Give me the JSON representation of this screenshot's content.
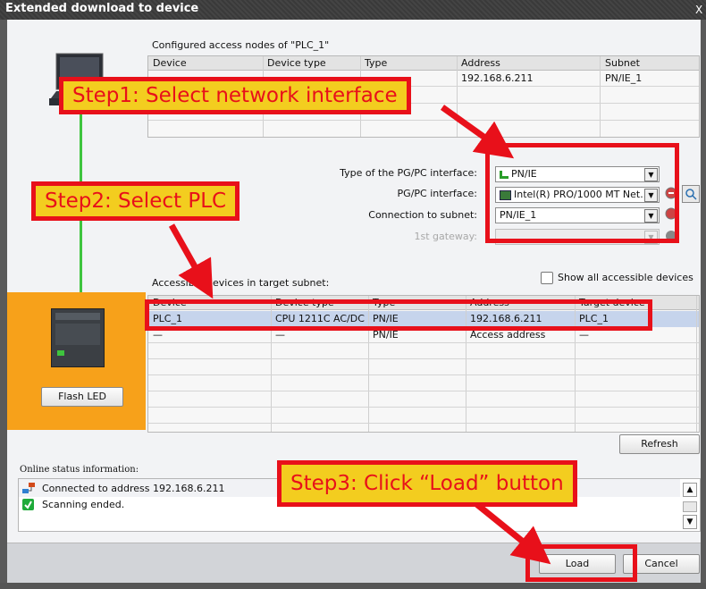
{
  "window": {
    "title": "Extended download to device",
    "close": "X"
  },
  "configured": {
    "heading": "Configured access nodes of \"PLC_1\"",
    "columns": [
      "Device",
      "Device type",
      "Type",
      "Address",
      "Subnet"
    ],
    "row": [
      "",
      "",
      "",
      "192.168.6.211",
      "PN/IE_1"
    ]
  },
  "interface": {
    "type_label": "Type of the PG/PC interface:",
    "type_value": "PN/IE",
    "pgpc_label": "PG/PC interface:",
    "pgpc_value": "Intel(R) PRO/1000 MT Net...",
    "subnet_label": "Connection to subnet:",
    "subnet_value": "PN/IE_1",
    "gateway_label": "1st gateway:",
    "gateway_value": ""
  },
  "accessible": {
    "heading": "Accessible devices in target subnet:",
    "show_all": "Show all accessible devices",
    "columns": [
      "Device",
      "Device type",
      "Type",
      "Address",
      "Target device"
    ],
    "rows": [
      [
        "PLC_1",
        "CPU 1211C AC/DC...",
        "PN/IE",
        "192.168.6.211",
        "PLC_1"
      ],
      [
        "—",
        "—",
        "PN/IE",
        "Access address",
        "—"
      ]
    ]
  },
  "buttons": {
    "flash_led": "Flash LED",
    "refresh": "Refresh",
    "load": "Load",
    "cancel": "Cancel"
  },
  "status": {
    "heading": "Online status information:",
    "lines": [
      "Connected to address 192.168.6.211",
      "Scanning ended."
    ]
  },
  "callouts": {
    "step1": "Step1: Select network interface",
    "step2": "Step2: Select PLC",
    "step3": "Step3: Click “Load” button"
  },
  "colors": {
    "highlight": "#e8101a",
    "callout_bg": "#f3cd1f",
    "panel_orange": "#f7a11a",
    "link_green": "#3ec43e"
  }
}
